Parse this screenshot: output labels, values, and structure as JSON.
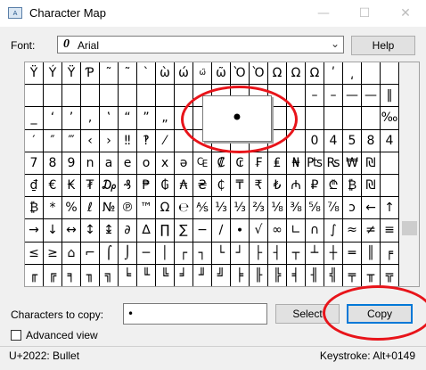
{
  "window": {
    "title": "Character Map",
    "icon_text": "A",
    "minimize": "—",
    "maximize": "☐",
    "close": "✕"
  },
  "font": {
    "label": "Font:",
    "value": "Arial",
    "icon": "0"
  },
  "help_button": "Help",
  "grid": {
    "rows": [
      [
        "Ÿ",
        "Ý",
        "Ÿ",
        "Ƥ",
        "˜",
        "˜",
        "ˋ",
        "ὼ",
        "ώ",
        "ώ̈",
        "ῶ",
        "Ὸ",
        "Ὸ",
        "Ω",
        "Ω",
        "Ω",
        "ʹ",
        "͵",
        "",
        ""
      ],
      [
        "",
        "",
        "",
        "",
        "",
        "",
        "",
        "",
        "",
        "",
        "",
        "",
        "",
        "",
        "",
        "–",
        "–",
        "—",
        "—",
        "‖"
      ],
      [
        "_",
        "‘",
        "’",
        "‚",
        "‛",
        "“",
        "”",
        "„",
        "",
        "",
        "",
        "",
        "",
        "",
        "",
        "",
        "",
        "",
        "",
        "‰"
      ],
      [
        "′",
        "″",
        "‴",
        "‹",
        "›",
        "‼",
        "‽",
        "⁄",
        "",
        "",
        "",
        "",
        "",
        "",
        "",
        "0",
        "4",
        "5",
        "8",
        "4"
      ],
      [
        "7",
        "8",
        "9",
        "n",
        "a",
        "e",
        "o",
        "x",
        "ə",
        "₠",
        "₡",
        "₢",
        "₣",
        "₤",
        "₦",
        "₧",
        "₨",
        "₩",
        "₪",
        ""
      ],
      [
        "₫",
        "€",
        "₭",
        "₮",
        "₯",
        "₰",
        "₱",
        "₲",
        "₳",
        "₴",
        "₵",
        "₸",
        "₹",
        "₺",
        "₼",
        "₽",
        "₾",
        "₿",
        "₪",
        ""
      ],
      [
        "₿",
        "*",
        "%",
        "ℓ",
        "№",
        "℗",
        "™",
        "Ω",
        "℮",
        "⅍",
        "⅓",
        "⅓",
        "⅔",
        "⅛",
        "⅜",
        "⅝",
        "⅞",
        "ↄ",
        "←",
        "↑"
      ],
      [
        "→",
        "↓",
        "↔",
        "↕",
        "↨",
        "∂",
        "∆",
        "∏",
        "∑",
        "−",
        "∕",
        "∙",
        "√",
        "∞",
        "∟",
        "∩",
        "∫",
        "≈",
        "≠",
        "≡"
      ],
      [
        "≤",
        "≥",
        "⌂",
        "⌐",
        "⌠",
        "⌡",
        "─",
        "│",
        "┌",
        "┐",
        "└",
        "┘",
        "├",
        "┤",
        "┬",
        "┴",
        "┼",
        "═",
        "║",
        "╒"
      ],
      [
        "╓",
        "╔",
        "╕",
        "╖",
        "╗",
        "╘",
        "╙",
        "╚",
        "╛",
        "╜",
        "╝",
        "╞",
        "╟",
        "╠",
        "╡",
        "╢",
        "╣",
        "╤",
        "╥",
        "╦"
      ]
    ]
  },
  "magnified_char": "•",
  "copy": {
    "label": "Characters to copy:",
    "value": "•"
  },
  "select_button": "Select",
  "copy_button": "Copy",
  "advanced_view": {
    "label": "Advanced view",
    "checked": false
  },
  "status": {
    "left": "U+2022: Bullet",
    "right": "Keystroke: Alt+0149"
  },
  "colors": {
    "annotation": "#e8141a",
    "accent": "#0078d7"
  }
}
